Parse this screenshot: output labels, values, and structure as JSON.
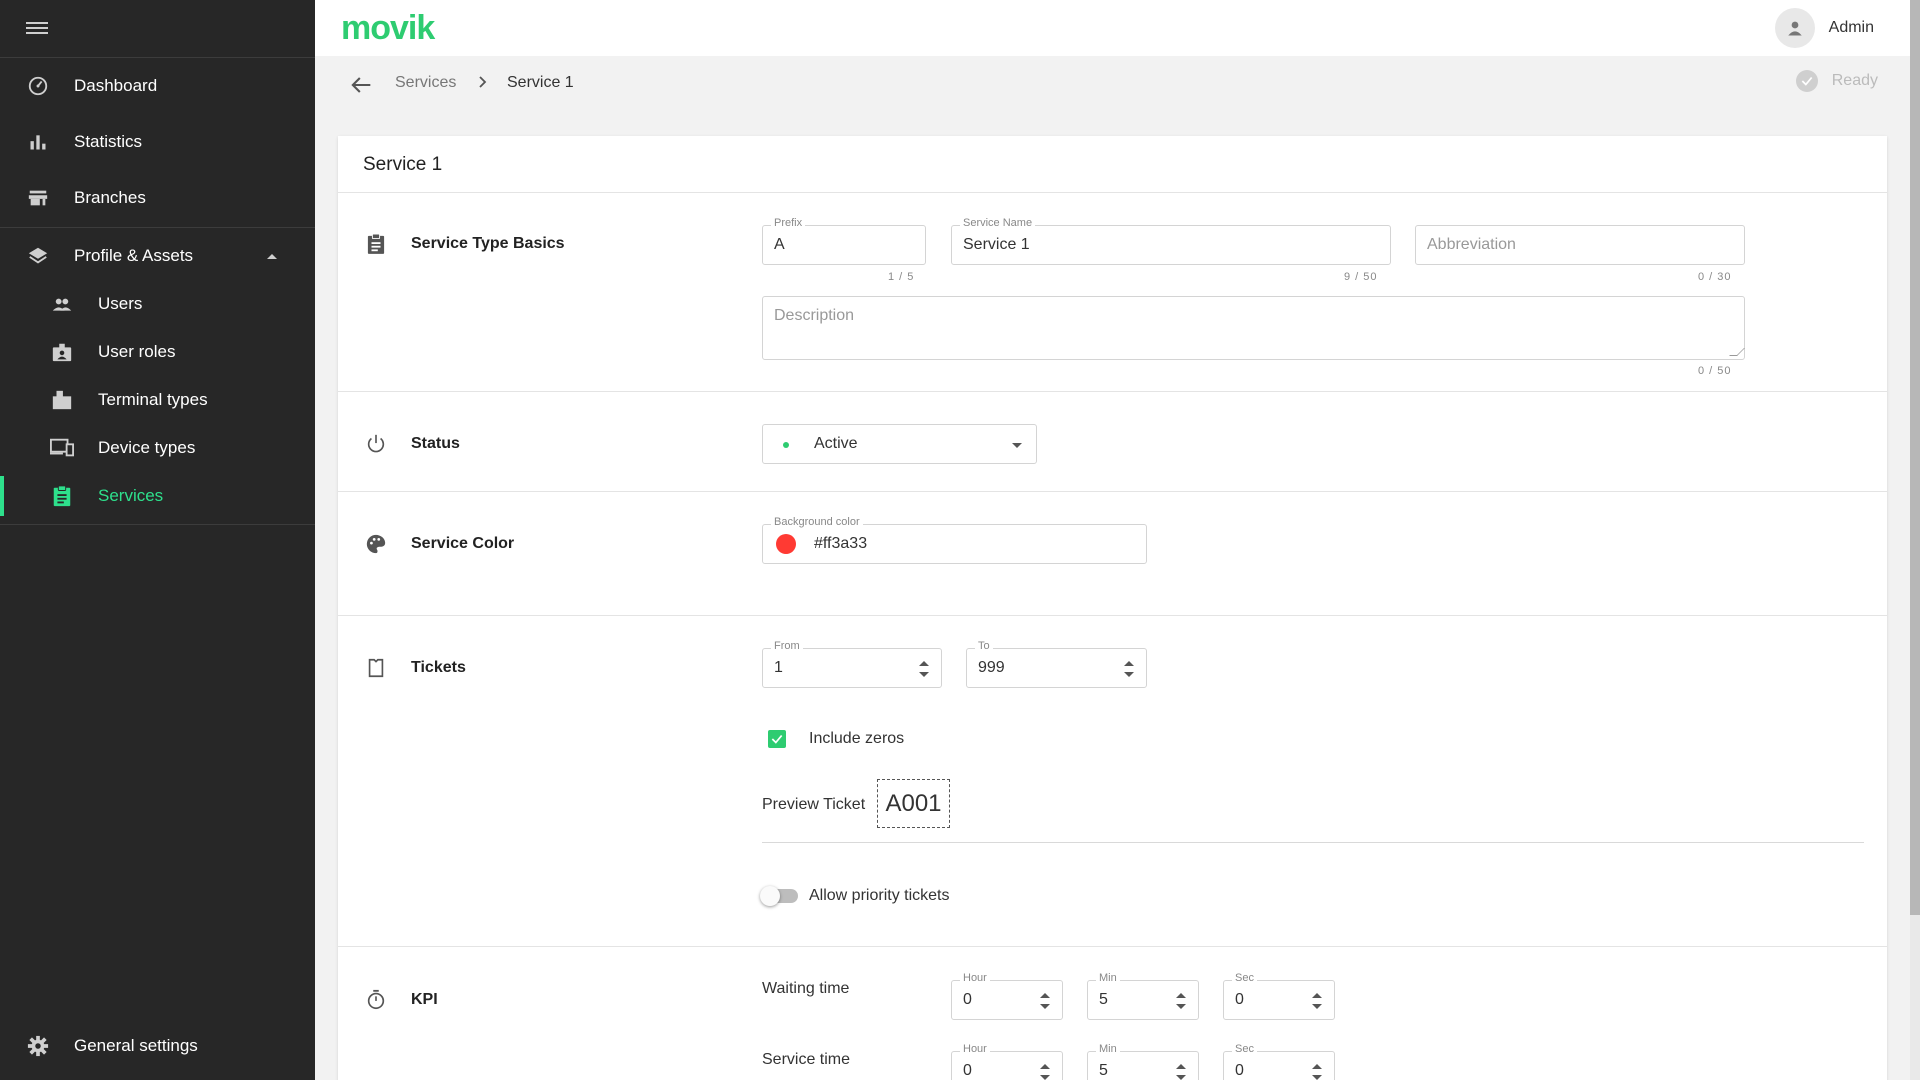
{
  "app": {
    "logo": "movik"
  },
  "sidebar": {
    "items": [
      {
        "label": "Dashboard",
        "icon": "dashboard-icon"
      },
      {
        "label": "Statistics",
        "icon": "bar-chart-icon"
      },
      {
        "label": "Branches",
        "icon": "store-icon"
      },
      {
        "label": "Profile & Assets",
        "icon": "layers-icon",
        "expanded": true
      },
      {
        "label": "Users",
        "icon": "users-icon"
      },
      {
        "label": "User roles",
        "icon": "badge-icon"
      },
      {
        "label": "Terminal types",
        "icon": "terminal-icon"
      },
      {
        "label": "Device types",
        "icon": "devices-icon"
      },
      {
        "label": "Services",
        "icon": "clipboard-icon",
        "active": true
      }
    ],
    "footer": {
      "label": "General settings",
      "icon": "gear-icon"
    }
  },
  "topbar": {
    "user_name": "Admin"
  },
  "breadcrumb": {
    "parent": "Services",
    "current": "Service 1",
    "status": "Ready"
  },
  "card": {
    "title": "Service 1"
  },
  "basics": {
    "label": "Service Type Basics",
    "prefix": {
      "label": "Prefix",
      "value": "A",
      "counter": "1 / 5"
    },
    "name": {
      "label": "Service Name",
      "value": "Service 1",
      "counter": "9 / 50"
    },
    "abbreviation": {
      "placeholder": "Abbreviation",
      "counter": "0 / 30"
    },
    "description": {
      "placeholder": "Description",
      "counter": "0 / 50"
    }
  },
  "status": {
    "label": "Status",
    "value": "Active"
  },
  "color": {
    "label": "Service Color",
    "field_label": "Background color",
    "value": "#ff3a33",
    "swatch": "#ff3a33"
  },
  "tickets": {
    "label": "Tickets",
    "from": {
      "label": "From",
      "value": "1"
    },
    "to": {
      "label": "To",
      "value": "999"
    },
    "include_zeros": {
      "label": "Include zeros",
      "checked": true
    },
    "preview": {
      "label": "Preview Ticket",
      "value": "A001"
    },
    "priority": {
      "label": "Allow priority tickets",
      "on": false
    }
  },
  "kpi": {
    "label": "KPI",
    "waiting": {
      "label": "Waiting time",
      "hour_label": "Hour",
      "hour": "0",
      "min_label": "Min",
      "min": "5",
      "sec_label": "Sec",
      "sec": "0"
    },
    "service": {
      "label": "Service time",
      "hour_label": "Hour",
      "hour": "0",
      "min_label": "Min",
      "min": "5",
      "sec_label": "Sec",
      "sec": "0"
    }
  },
  "colors": {
    "accent": "#2ee08c",
    "brand": "#2ecc71",
    "sidebar_bg": "#272727"
  }
}
